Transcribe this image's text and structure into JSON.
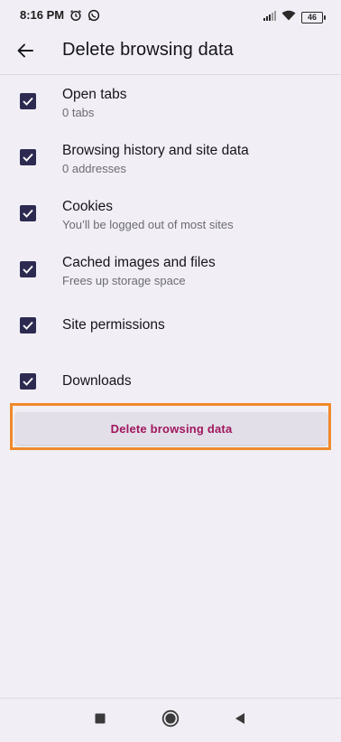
{
  "status_bar": {
    "time": "8:16 PM",
    "battery": "46"
  },
  "toolbar": {
    "title": "Delete browsing data"
  },
  "options": [
    {
      "title": "Open tabs",
      "subtitle": "0 tabs",
      "checked": true
    },
    {
      "title": "Browsing history and site data",
      "subtitle": "0 addresses",
      "checked": true
    },
    {
      "title": "Cookies",
      "subtitle": "You’ll be logged out of most sites",
      "checked": true
    },
    {
      "title": "Cached images and files",
      "subtitle": "Frees up storage space",
      "checked": true
    },
    {
      "title": "Site permissions",
      "subtitle": "",
      "checked": true
    },
    {
      "title": "Downloads",
      "subtitle": "",
      "checked": true
    }
  ],
  "action": {
    "delete_label": "Delete browsing data"
  },
  "colors": {
    "checkbox": "#2d2a51",
    "accent_text": "#a0185e",
    "highlight": "#f08a2c",
    "background": "#f1eff5"
  },
  "icons": {
    "back": "arrow-left-icon",
    "alarm": "alarm-icon",
    "whatsapp": "whatsapp-icon",
    "signal": "signal-icon",
    "wifi": "wifi-icon",
    "nav_recents": "square-icon",
    "nav_home": "circle-icon",
    "nav_back": "triangle-back-icon"
  }
}
